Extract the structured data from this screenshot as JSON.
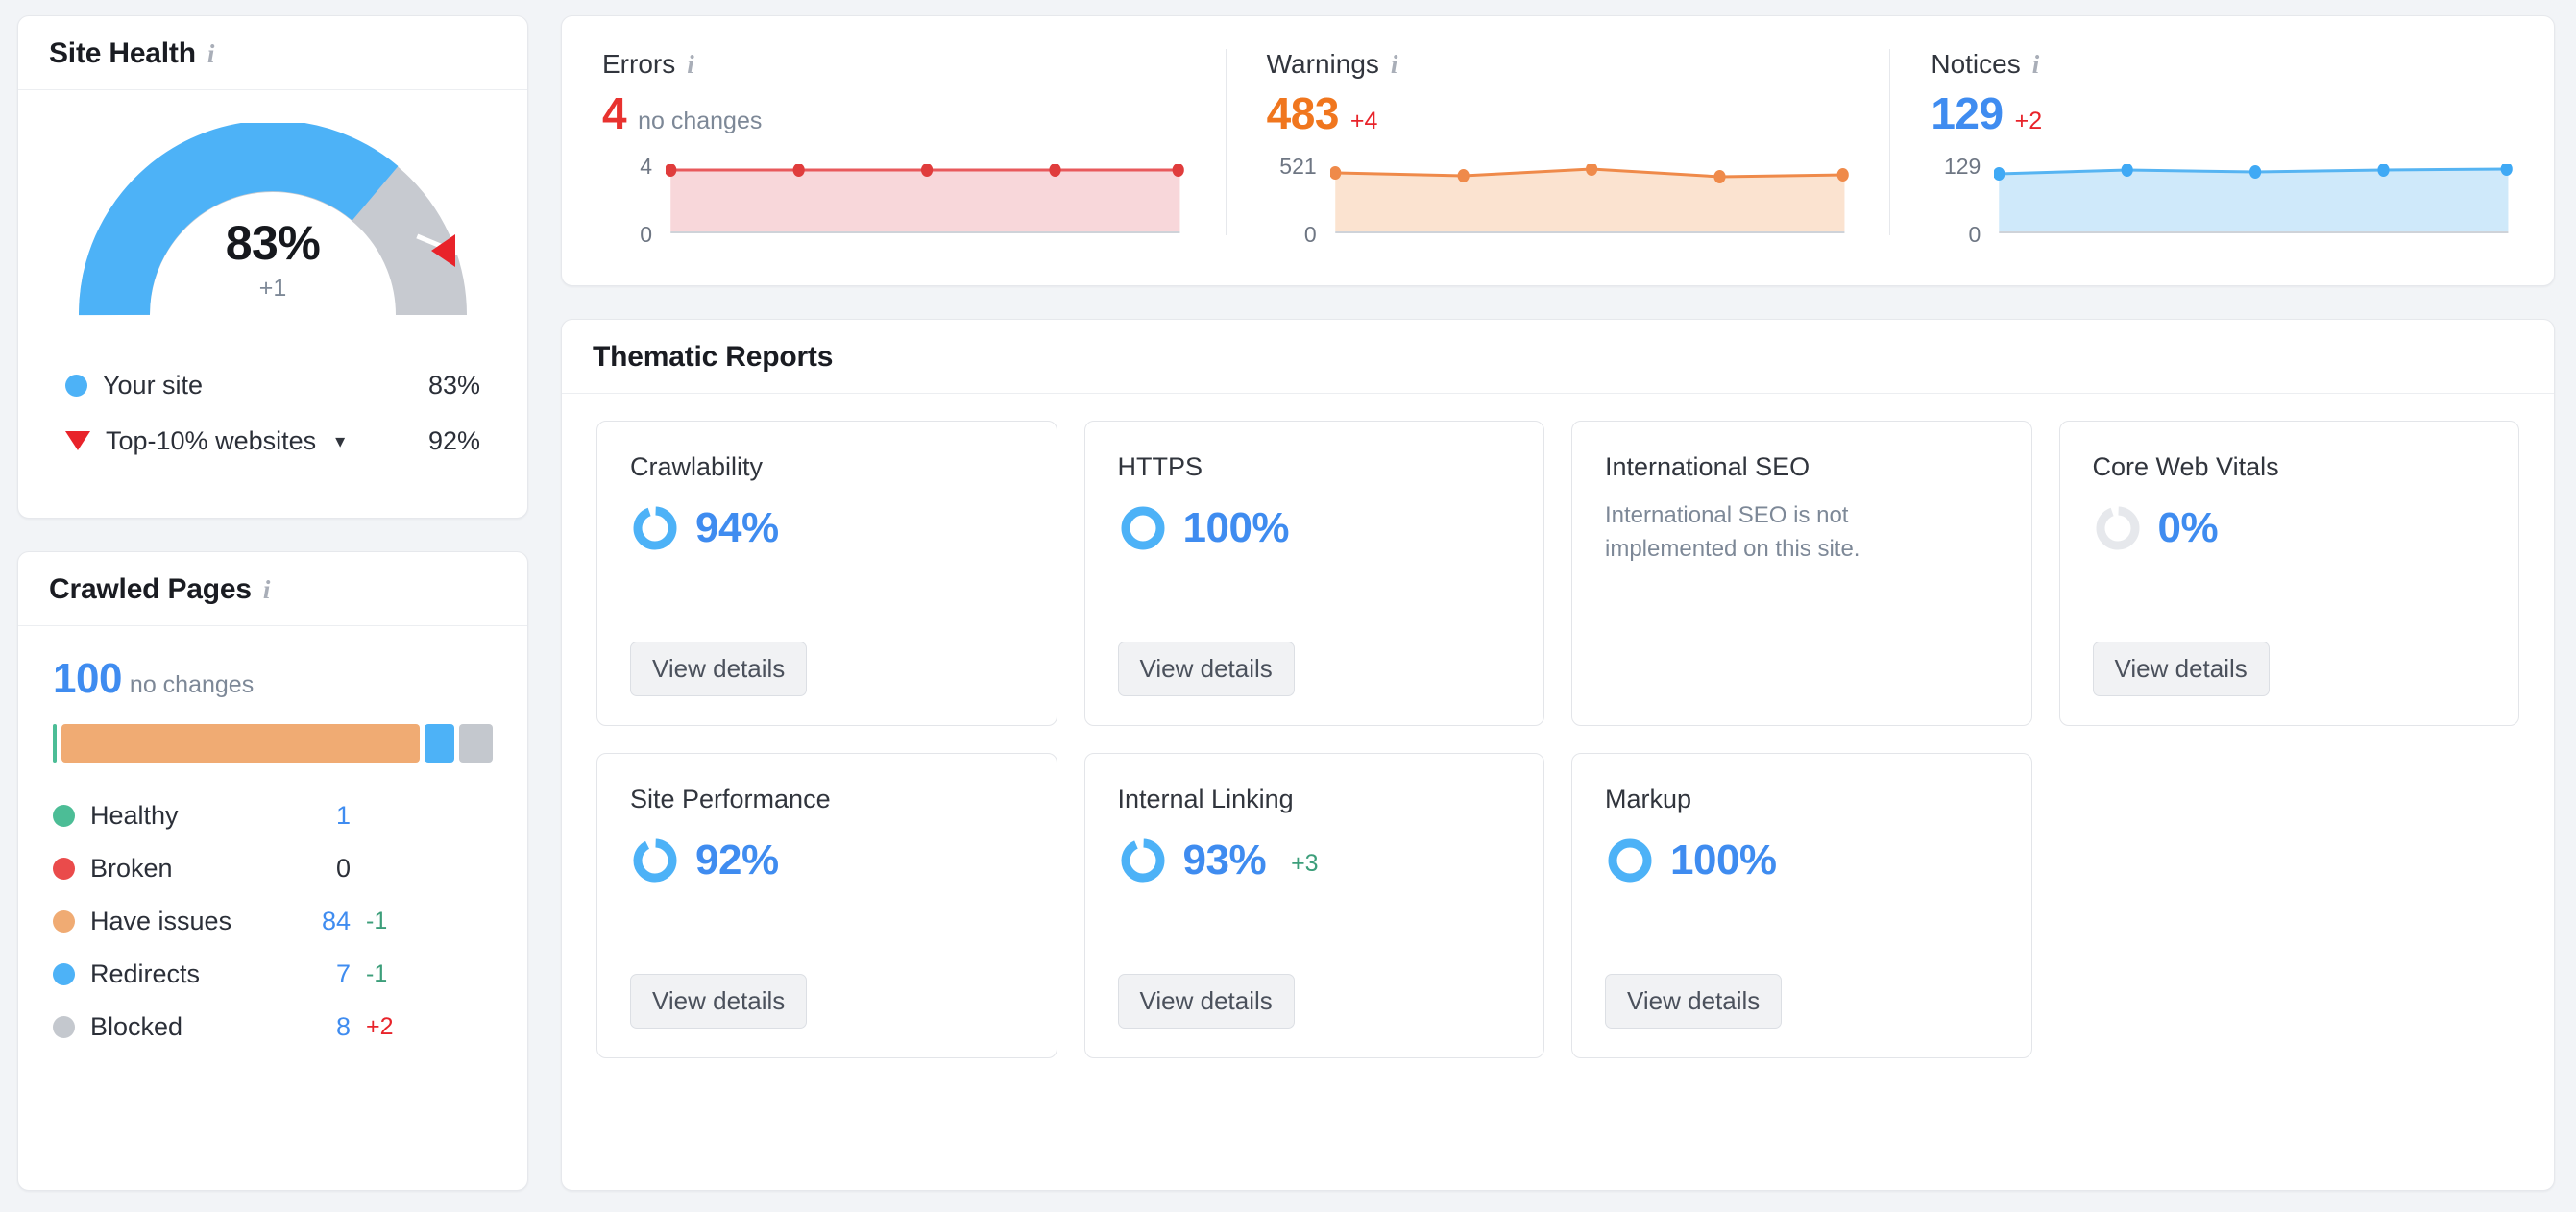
{
  "site_health": {
    "title": "Site Health",
    "info_icon": "info-icon",
    "score": "83%",
    "delta": "+1",
    "gauge_value": 83,
    "benchmark_value": 92,
    "legend": [
      {
        "marker": "circle",
        "color": "#4db2f7",
        "label": "Your site",
        "value": "83%"
      },
      {
        "marker": "triangle-down",
        "color": "#e8232a",
        "label": "Top-10% websites",
        "chevron": "⌄",
        "value": "92%"
      }
    ]
  },
  "crawled_pages": {
    "title": "Crawled Pages",
    "info_icon": "info-icon",
    "total": "100",
    "total_sub": "no changes",
    "segments": [
      {
        "label": "Healthy",
        "color": "#4cbd96",
        "value": 1
      },
      {
        "label": "Have issues",
        "color": "#f0ab73",
        "value": 84
      },
      {
        "label": "Redirects",
        "color": "#4db2f7",
        "value": 7
      },
      {
        "label": "Blocked",
        "color": "#c4c8ce",
        "value": 8
      }
    ],
    "rows": [
      {
        "label": "Healthy",
        "color": "#4cbd96",
        "value": "1",
        "delta": "",
        "delta_dir": ""
      },
      {
        "label": "Broken",
        "color": "#ea4b4b",
        "value": "0",
        "delta": "",
        "delta_dir": ""
      },
      {
        "label": "Have issues",
        "color": "#f0ab73",
        "value": "84",
        "delta": "-1",
        "delta_dir": "down"
      },
      {
        "label": "Redirects",
        "color": "#4db2f7",
        "value": "7",
        "delta": "-1",
        "delta_dir": "down"
      },
      {
        "label": "Blocked",
        "color": "#c4c8ce",
        "value": "8",
        "delta": "+2",
        "delta_dir": "up"
      }
    ]
  },
  "issues": [
    {
      "label": "Errors",
      "info_icon": "info-icon",
      "value": "4",
      "value_color": "#e8322f",
      "delta": "no changes",
      "delta_dir": "none",
      "axis_top": "4",
      "axis_bottom": "0"
    },
    {
      "label": "Warnings",
      "info_icon": "info-icon",
      "value": "483",
      "value_color": "#f0761e",
      "delta": "+4",
      "delta_dir": "up",
      "axis_top": "521",
      "axis_bottom": "0"
    },
    {
      "label": "Notices",
      "info_icon": "info-icon",
      "value": "129",
      "value_color": "#3f8cf0",
      "delta": "+2",
      "delta_dir": "up",
      "axis_top": "129",
      "axis_bottom": "0"
    }
  ],
  "thematic": {
    "title": "Thematic Reports",
    "view_details_label": "View details",
    "cards": [
      {
        "name": "Crawlability",
        "percent": "94%",
        "ring": 94,
        "delta": "",
        "note": "",
        "has_button": true
      },
      {
        "name": "HTTPS",
        "percent": "100%",
        "ring": 100,
        "delta": "",
        "note": "",
        "has_button": true
      },
      {
        "name": "International SEO",
        "percent": "",
        "ring": null,
        "delta": "",
        "note": "International SEO is not implemented on this site.",
        "has_button": false
      },
      {
        "name": "Core Web Vitals",
        "percent": "0%",
        "ring": 0,
        "delta": "",
        "note": "",
        "has_button": true
      },
      {
        "name": "Site Performance",
        "percent": "92%",
        "ring": 92,
        "delta": "",
        "note": "",
        "has_button": true
      },
      {
        "name": "Internal Linking",
        "percent": "93%",
        "ring": 93,
        "delta": "+3",
        "note": "",
        "has_button": true
      },
      {
        "name": "Markup",
        "percent": "100%",
        "ring": 100,
        "delta": "",
        "note": "",
        "has_button": true
      }
    ]
  },
  "chart_data": [
    {
      "type": "line",
      "title": "Errors",
      "x": [
        1,
        2,
        3,
        4,
        5
      ],
      "values": [
        4,
        4,
        4,
        4,
        4
      ],
      "ylim": [
        0,
        4
      ],
      "ytick_labels": [
        "0",
        "4"
      ],
      "line_color": "#e8595c",
      "fill_color": "#f8d7da",
      "grid": false,
      "legend": "none"
    },
    {
      "type": "line",
      "title": "Warnings",
      "x": [
        1,
        2,
        3,
        4,
        5
      ],
      "values": [
        515,
        510,
        521,
        508,
        511
      ],
      "ylim": [
        0,
        521
      ],
      "ytick_labels": [
        "0",
        "521"
      ],
      "line_color": "#ef8a4a",
      "fill_color": "#fbe3d0",
      "grid": false,
      "legend": "none"
    },
    {
      "type": "line",
      "title": "Notices",
      "x": [
        1,
        2,
        3,
        4,
        5
      ],
      "values": [
        127,
        129,
        128,
        129,
        129
      ],
      "ylim": [
        0,
        129
      ],
      "ytick_labels": [
        "0",
        "129"
      ],
      "line_color": "#56b4f2",
      "fill_color": "#cfe9fa",
      "grid": false,
      "legend": "none"
    },
    {
      "type": "pie",
      "title": "Site Health gauge",
      "categories": [
        "Your site",
        "Remaining",
        "Top-10% websites benchmark"
      ],
      "values": [
        83,
        17,
        92
      ],
      "ylim": [
        0,
        100
      ],
      "legend": "bottom"
    },
    {
      "type": "bar",
      "title": "Crawled Pages distribution",
      "categories": [
        "Healthy",
        "Broken",
        "Have issues",
        "Redirects",
        "Blocked"
      ],
      "values": [
        1,
        0,
        84,
        7,
        8
      ],
      "ylim": [
        0,
        100
      ],
      "legend": "bottom"
    }
  ]
}
